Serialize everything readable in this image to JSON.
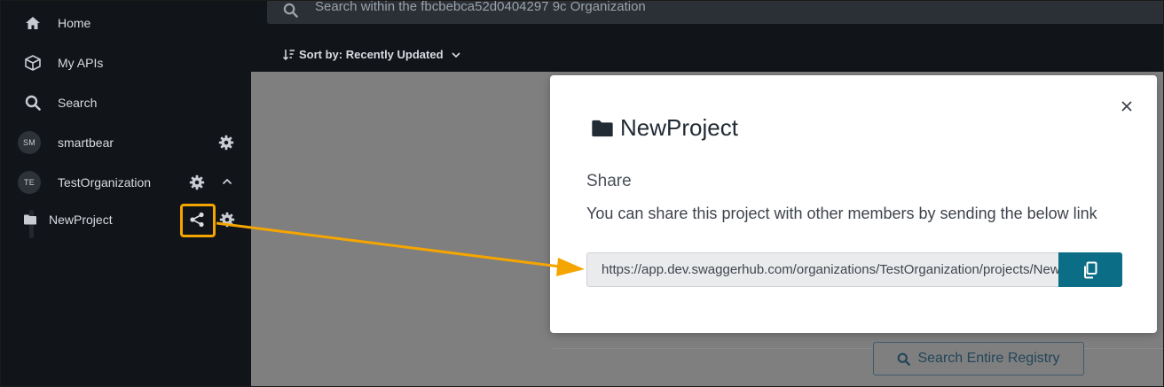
{
  "sidebar": {
    "items": [
      {
        "label": "Home",
        "icon": "home-icon"
      },
      {
        "label": "My APIs",
        "icon": "cube-icon"
      },
      {
        "label": "Search",
        "icon": "search-icon"
      }
    ],
    "orgs": [
      {
        "initials": "SM",
        "label": "smartbear"
      },
      {
        "initials": "TE",
        "label": "TestOrganization"
      }
    ],
    "project": {
      "label": "NewProject"
    }
  },
  "topbar": {
    "search_placeholder": "Search within the fbcbebca52d0404297 9c Organization",
    "sort_label": "Sort by: Recently Updated"
  },
  "registry_button": {
    "label": "Search Entire Registry"
  },
  "modal": {
    "title": "NewProject",
    "share_heading": "Share",
    "share_description": "You can share this project with other members by sending the below link",
    "link_value": "https://app.dev.swaggerhub.com/organizations/TestOrganization/projects/NewProject"
  },
  "colors": {
    "sidebar_bg": "#111419",
    "accent": "#0b6d86",
    "annotation": "#f5a500"
  }
}
